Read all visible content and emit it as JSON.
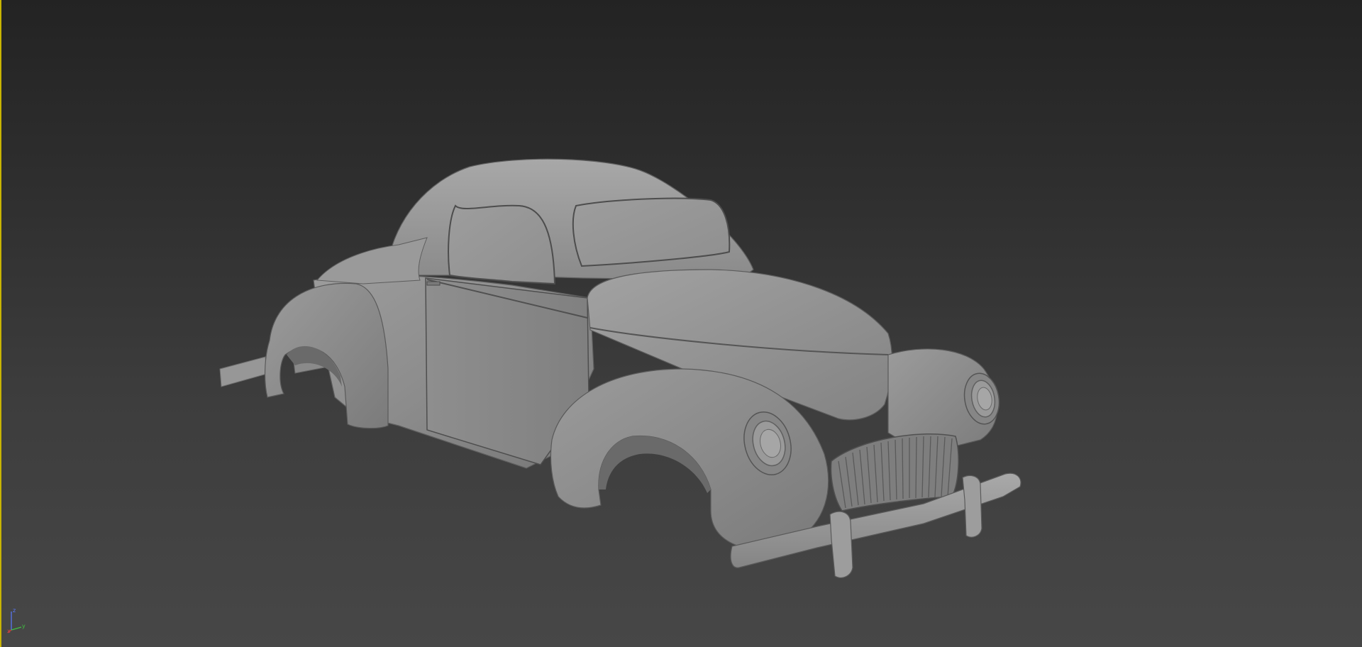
{
  "viewport": {
    "active_border_color": "#c8b400",
    "model": "car-body-mesh"
  },
  "axis_gizmo": {
    "x_label": "x",
    "y_label": "y",
    "z_label": "z",
    "x_color": "#d04040",
    "y_color": "#40c040",
    "z_color": "#5a7aff"
  }
}
